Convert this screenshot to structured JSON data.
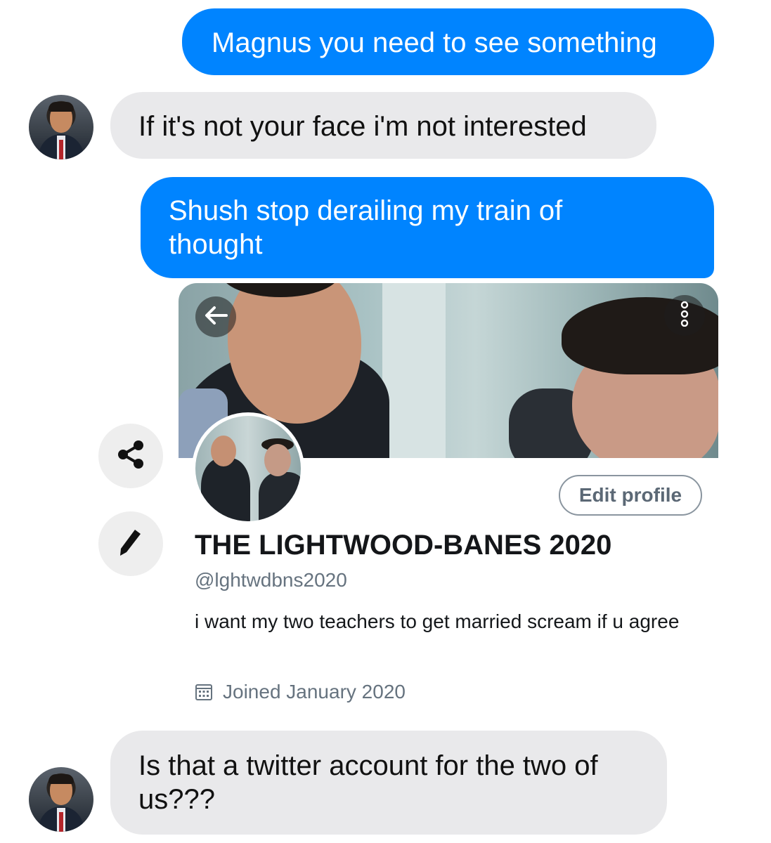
{
  "messages": [
    {
      "direction": "outgoing",
      "text": "Magnus you need to see something"
    },
    {
      "direction": "incoming",
      "text": "If it's not your face i'm not interested"
    },
    {
      "direction": "outgoing",
      "text": "Shush stop derailing my train of thought"
    },
    {
      "direction": "incoming",
      "text": "Is that a twitter account for the two of us???"
    }
  ],
  "twitter_profile": {
    "display_name": "THE LIGHTWOOD-BANES 2020",
    "handle": "@lghtwdbns2020",
    "bio": "i want my two teachers to get married scream if u agree",
    "joined": "Joined January 2020",
    "edit_profile_label": "Edit profile"
  },
  "icons": {
    "back": "arrow-left-icon",
    "more": "more-vertical-icon",
    "share": "share-icon",
    "edit": "pencil-icon",
    "calendar": "calendar-icon"
  },
  "colors": {
    "outgoing_bubble": "#0084ff",
    "incoming_bubble": "#e9e9eb",
    "secondary_text": "#66737f"
  }
}
